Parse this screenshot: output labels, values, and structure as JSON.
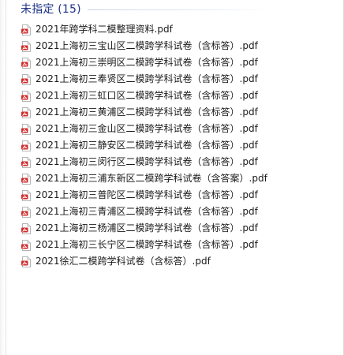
{
  "group": {
    "title": "未指定 (15)"
  },
  "colors": {
    "group_title": "#1e3287",
    "pdf_icon": "#d32b2b",
    "text": "#1a1a1a"
  },
  "files": [
    {
      "name": "2021年跨学科二模整理资料.pdf",
      "icon": "pdf-icon"
    },
    {
      "name": "2021上海初三宝山区二模跨学科试卷（含标答）.pdf",
      "icon": "pdf-icon"
    },
    {
      "name": "2021上海初三崇明区二模跨学科试卷（含标答）.pdf",
      "icon": "pdf-icon"
    },
    {
      "name": "2021上海初三奉贤区二模跨学科试卷（含标答）.pdf",
      "icon": "pdf-icon"
    },
    {
      "name": "2021上海初三虹口区二模跨学科试卷（含标答）.pdf",
      "icon": "pdf-icon"
    },
    {
      "name": "2021上海初三黄浦区二模跨学科试卷（含标答）.pdf",
      "icon": "pdf-icon"
    },
    {
      "name": "2021上海初三金山区二模跨学科试卷（含标答）.pdf",
      "icon": "pdf-icon"
    },
    {
      "name": "2021上海初三静安区二模跨学科试卷（含标答）.pdf",
      "icon": "pdf-icon"
    },
    {
      "name": "2021上海初三闵行区二模跨学科试卷（含标答）.pdf",
      "icon": "pdf-icon"
    },
    {
      "name": "2021上海初三浦东新区二模跨学科试卷（含答案）.pdf",
      "icon": "pdf-icon"
    },
    {
      "name": "2021上海初三普陀区二模跨学科试卷（含标答）.pdf",
      "icon": "pdf-icon"
    },
    {
      "name": "2021上海初三青浦区二模跨学科试卷（含标答）.pdf",
      "icon": "pdf-icon"
    },
    {
      "name": "2021上海初三杨浦区二模跨学科试卷（含标答）.pdf",
      "icon": "pdf-icon"
    },
    {
      "name": "2021上海初三长宁区二模跨学科试卷（含标答）.pdf",
      "icon": "pdf-icon"
    },
    {
      "name": "2021徐汇二模跨学科试卷（含标答）.pdf",
      "icon": "pdf-icon"
    }
  ]
}
